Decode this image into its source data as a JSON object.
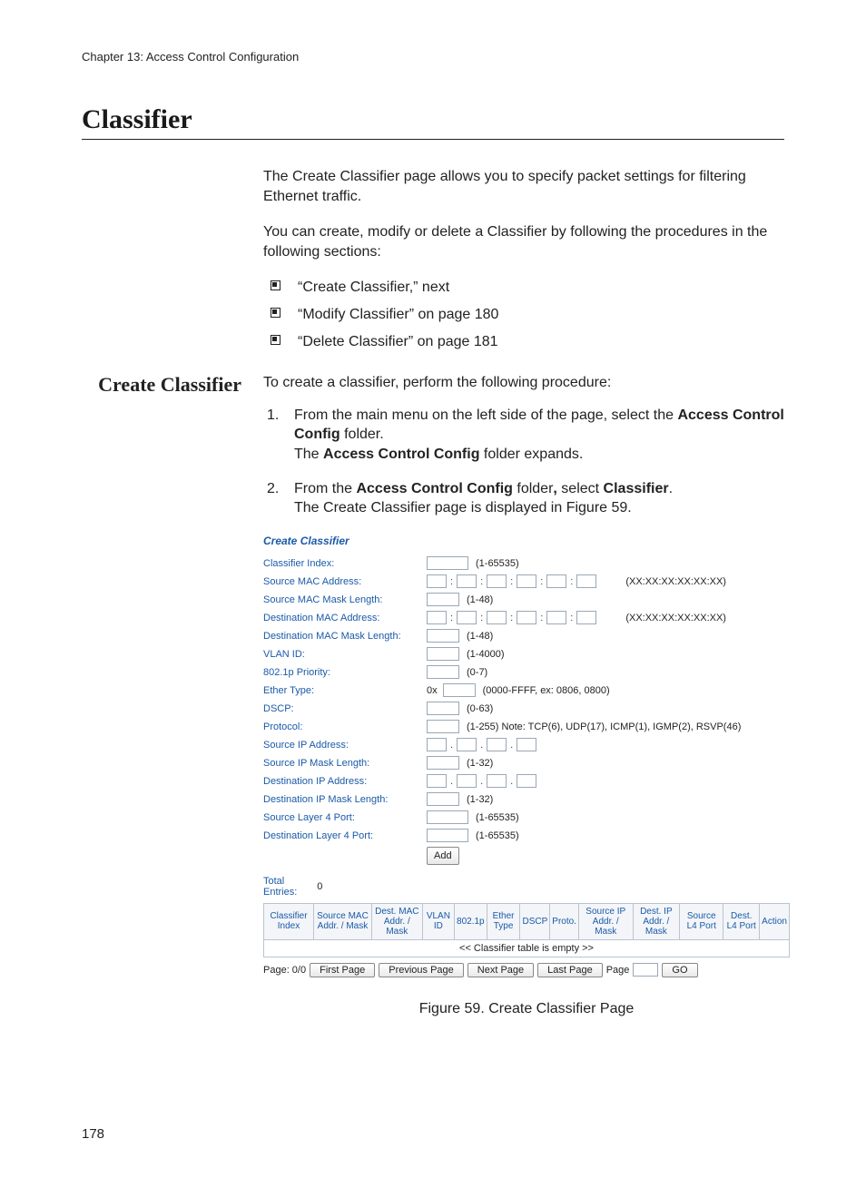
{
  "header": {
    "chapter": "Chapter 13: Access Control Configuration"
  },
  "title": "Classifier",
  "intro": {
    "p1": "The Create Classifier page allows you to specify packet settings for filtering Ethernet traffic.",
    "p2": "You can create, modify or delete a Classifier by following the procedures in the following sections:"
  },
  "links": [
    "“Create Classifier,”  next",
    "“Modify Classifier” on page 180",
    "“Delete Classifier” on page 181"
  ],
  "subsection": {
    "heading": "Create Classifier",
    "lead": "To create a classifier, perform the following procedure:",
    "steps": {
      "s1a": "From the main menu on the left side of the page, select the ",
      "s1b": "Access Control Config",
      "s1c": " folder.",
      "s1d": "The ",
      "s1e": "Access Control Config",
      "s1f": " folder expands.",
      "s2a": "From the ",
      "s2b": "Access Control Config",
      "s2c": " folder",
      "s2d": ",",
      "s2e": " select ",
      "s2f": "Classifier",
      "s2g": ".",
      "s2h": "The Create Classifier page is displayed in Figure 59."
    }
  },
  "screenshot": {
    "title": "Create Classifier",
    "rows": {
      "classifier_index": {
        "label": "Classifier Index:",
        "hint": "(1-65535)"
      },
      "src_mac": {
        "label": "Source MAC Address:",
        "hint": "(XX:XX:XX:XX:XX:XX)"
      },
      "src_mac_mask": {
        "label": "Source MAC Mask Length:",
        "hint": "(1-48)"
      },
      "dst_mac": {
        "label": "Destination MAC Address:",
        "hint": "(XX:XX:XX:XX:XX:XX)"
      },
      "dst_mac_mask": {
        "label": "Destination MAC Mask Length:",
        "hint": "(1-48)"
      },
      "vlan": {
        "label": "VLAN ID:",
        "hint": "(1-4000)"
      },
      "prio": {
        "label": "802.1p Priority:",
        "hint": "(0-7)"
      },
      "ether": {
        "label": "Ether Type:",
        "prefix": "0x",
        "hint": "(0000-FFFF, ex: 0806, 0800)"
      },
      "dscp": {
        "label": "DSCP:",
        "hint": "(0-63)"
      },
      "proto": {
        "label": "Protocol:",
        "hint": "(1-255) Note: TCP(6), UDP(17), ICMP(1), IGMP(2), RSVP(46)"
      },
      "src_ip": {
        "label": "Source IP Address:"
      },
      "src_ip_mask": {
        "label": "Source IP Mask Length:",
        "hint": "(1-32)"
      },
      "dst_ip": {
        "label": "Destination IP Address:"
      },
      "dst_ip_mask": {
        "label": "Destination IP Mask Length:",
        "hint": "(1-32)"
      },
      "src_l4": {
        "label": "Source Layer 4 Port:",
        "hint": "(1-65535)"
      },
      "dst_l4": {
        "label": "Destination Layer 4 Port:",
        "hint": "(1-65535)"
      }
    },
    "add_btn": "Add",
    "total_label": "Total\nEntries:",
    "total_value": "0",
    "table": {
      "headers": [
        "Classifier Index",
        "Source MAC Addr. / Mask",
        "Dest. MAC Addr. / Mask",
        "VLAN ID",
        "802.1p",
        "Ether Type",
        "DSCP",
        "Proto.",
        "Source IP Addr. / Mask",
        "Dest. IP Addr. / Mask",
        "Source L4 Port",
        "Dest. L4 Port",
        "Action"
      ],
      "empty": "<< Classifier table is empty >>"
    },
    "pager": {
      "page_label": "Page: 0/0",
      "first": "First Page",
      "prev": "Previous Page",
      "next": "Next Page",
      "last": "Last Page",
      "page_word": "Page",
      "go": "GO"
    }
  },
  "figure_caption": "Figure 59. Create Classifier Page",
  "page_number": "178"
}
